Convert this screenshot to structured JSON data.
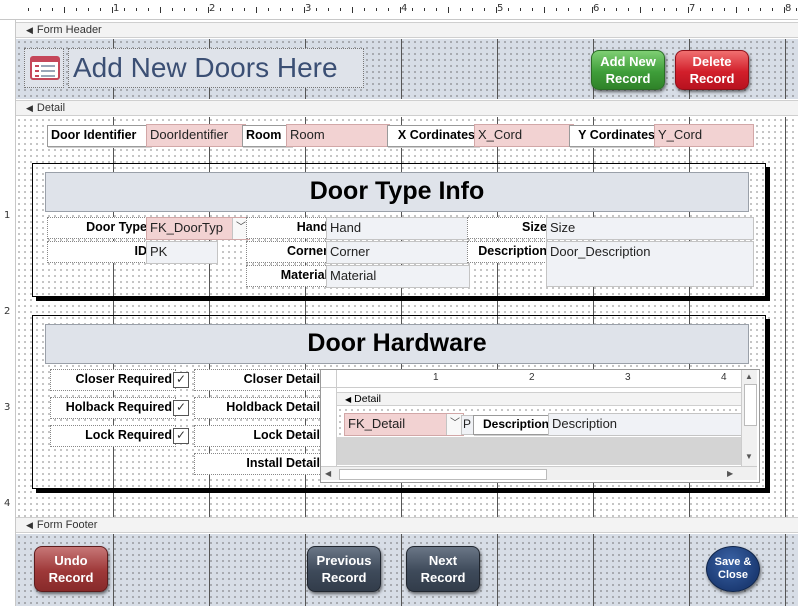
{
  "ruler": {
    "h_labels": [
      "1",
      "2",
      "3",
      "4",
      "5",
      "6",
      "7",
      "8"
    ],
    "v_labels": [
      "1",
      "2",
      "3",
      "4"
    ]
  },
  "sections": {
    "header": "Form Header",
    "detail": "Detail",
    "footer": "Form Footer"
  },
  "header": {
    "title": "Add New Doors Here",
    "add_new_record": "Add New Record",
    "delete_record": "Delete Record"
  },
  "detail": {
    "door_identifier_label": "Door Identifier",
    "door_identifier_value": "DoorIdentifier",
    "room_label": "Room",
    "room_value": "Room",
    "x_label": "X Cordinates",
    "x_value": "X_Cord",
    "y_label": "Y Cordinates",
    "y_value": "Y_Cord"
  },
  "door_type": {
    "banner": "Door Type Info",
    "door_type_label": "Door Type",
    "door_type_value": "FK_DoorTyp",
    "id_label": "ID",
    "id_value": "PK",
    "hand_label": "Hand",
    "hand_value": "Hand",
    "corner_label": "Corner",
    "corner_value": "Corner",
    "material_label": "Material",
    "material_value": "Material",
    "size_label": "Size",
    "size_value": "Size",
    "description_label": "Description",
    "description_value": "Door_Description"
  },
  "hardware": {
    "banner": "Door Hardware",
    "closer_required": "Closer Required",
    "holdback_required": "Holback Required",
    "lock_required": "Lock Required",
    "closer_detail": "Closer Detail",
    "holdback_detail": "Holdback Detail",
    "lock_detail": "Lock Detail",
    "install_detail": "Install Detail",
    "subform": {
      "ruler_labels": [
        "1",
        "2",
        "3",
        "4"
      ],
      "section": "Detail",
      "fk_detail": "FK_Detail",
      "p_value": "P",
      "description_label": "Description",
      "description_value": "Description"
    }
  },
  "footer": {
    "undo_record": "Undo Record",
    "previous_record": "Previous Record",
    "next_record": "Next Record",
    "save_close": "Save & Close"
  },
  "colors": {
    "grid": "#d7dde6",
    "pink_field": "#f2d2d2",
    "green_button": "#3f9e3a",
    "red_button": "#d21f2b"
  }
}
